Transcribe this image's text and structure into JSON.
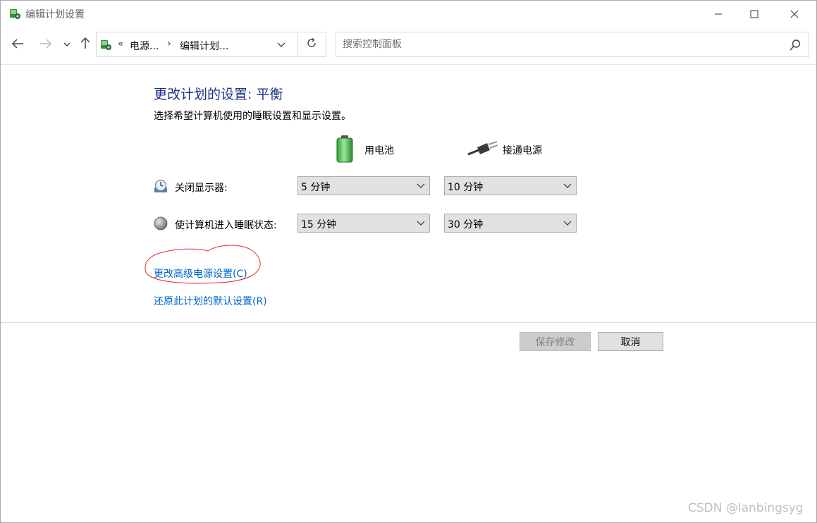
{
  "window": {
    "title": "编辑计划设置",
    "icon": "power-options-icon",
    "controls": [
      "minimize-icon",
      "maximize-icon",
      "close-icon"
    ]
  },
  "navbar": {
    "breadcrumb_prefix": "«",
    "breadcrumb_items": [
      "电源...",
      "编辑计划..."
    ],
    "breadcrumb_separator": "›",
    "search_placeholder": "搜索控制面板"
  },
  "main": {
    "heading": "更改计划的设置: 平衡",
    "subtitle": "选择希望计算机使用的睡眠设置和显示设置。",
    "columns": {
      "battery": "用电池",
      "plugged": "接通电源"
    },
    "rows": [
      {
        "label": "关闭显示器:",
        "icon": "display-timer-icon",
        "battery_value": "5 分钟",
        "plugged_value": "10 分钟"
      },
      {
        "label": "使计算机进入睡眠状态:",
        "icon": "sleep-moon-icon",
        "battery_value": "15 分钟",
        "plugged_value": "30 分钟"
      }
    ],
    "links": {
      "advanced": "更改高级电源设置(C)",
      "restore": "还原此计划的默认设置(R)"
    }
  },
  "footer": {
    "save_label": "保存修改",
    "cancel_label": "取消"
  },
  "watermark": "CSDN @lanbingsyg",
  "colors": {
    "heading": "#1e3287",
    "link": "#0066cc",
    "annotation": "#e0262b"
  }
}
